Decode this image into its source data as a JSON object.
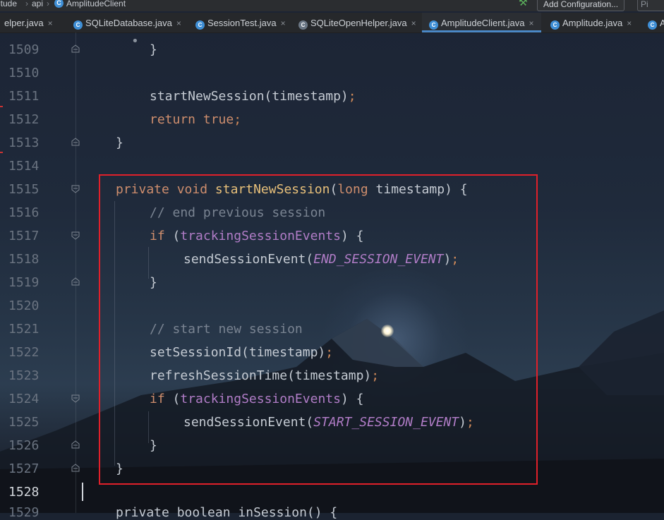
{
  "breadcrumb": {
    "items": [
      "itude",
      "api",
      "AmplitudeClient"
    ],
    "add_configuration": "Add Configuration...",
    "cut_right": "Pi"
  },
  "tabs": [
    {
      "label": "elper.java",
      "icon": "class-icon",
      "active": false
    },
    {
      "label": "SQLiteDatabase.java",
      "icon": "class-icon",
      "active": false
    },
    {
      "label": "SessionTest.java",
      "icon": "class-icon",
      "active": false
    },
    {
      "label": "SQLiteOpenHelper.java",
      "icon": "abstract-class-icon",
      "active": false
    },
    {
      "label": "AmplitudeClient.java",
      "icon": "class-icon",
      "active": true
    },
    {
      "label": "Amplitude.java",
      "icon": "class-icon",
      "active": false
    },
    {
      "label": "A",
      "icon": "class-icon",
      "active": false
    }
  ],
  "editor": {
    "line_numbers": [
      "1509",
      "1510",
      "1511",
      "1512",
      "1513",
      "1514",
      "1515",
      "1516",
      "1517",
      "1518",
      "1519",
      "1520",
      "1521",
      "1522",
      "1523",
      "1524",
      "1525",
      "1526",
      "1527",
      "1528",
      "1529"
    ],
    "current_line": "1528",
    "code": {
      "l1509": "}",
      "l1511_call": "startNewSession(timestamp)",
      "l1512_return": "return",
      "l1512_true": "true",
      "l1513": "}",
      "l1515_private": "private",
      "l1515_void": "void",
      "l1515_name": "startNewSession",
      "l1515_long": "long",
      "l1515_param": "timestamp",
      "l1516_comment": "// end previous session",
      "l1517_if": "if",
      "l1517_field": "trackingSessionEvents",
      "l1518_call": "sendSessionEvent",
      "l1518_const": "END_SESSION_EVENT",
      "l1519": "}",
      "l1521_comment": "// start new session",
      "l1522_call": "setSessionId(timestamp)",
      "l1523_call": "refreshSessionTime(timestamp)",
      "l1524_if": "if",
      "l1524_field": "trackingSessionEvents",
      "l1525_call": "sendSessionEvent",
      "l1525_const": "START_SESSION_EVENT",
      "l1526": "}",
      "l1527": "}",
      "l1529_partial": "private boolean inSession() {"
    }
  },
  "colors": {
    "keyword": "#cf8e6d",
    "method": "#e8c07a",
    "field": "#b07cc6",
    "comment": "#7a8492",
    "highlight_box": "#e0202a",
    "active_tab_underline": "#4a88c7"
  }
}
